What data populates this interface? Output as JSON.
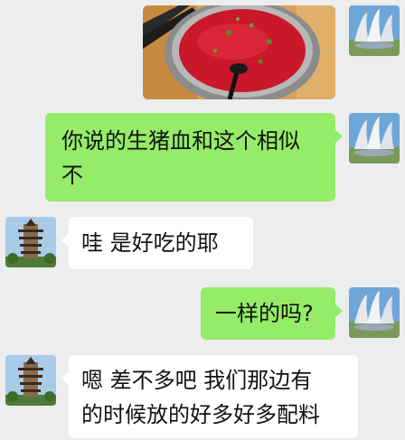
{
  "chat": {
    "messages": [
      {
        "sender": "self",
        "type": "image",
        "image_alt": "a bowl of raw pig blood with a ladle"
      },
      {
        "sender": "self",
        "type": "text",
        "text": "你说的生猪血和这个相似\n不"
      },
      {
        "sender": "other",
        "type": "text",
        "text": "哇 是好吃的耶"
      },
      {
        "sender": "self",
        "type": "text",
        "text": "一样的吗?"
      },
      {
        "sender": "other",
        "type": "text",
        "text": "嗯 差不多吧 我们那边有\n的时候放的好多好多配料"
      }
    ],
    "colors": {
      "background": "#ededed",
      "self_bubble": "#95ec69",
      "other_bubble": "#ffffff"
    },
    "avatars": {
      "self_icon": "sail-roof-building-icon",
      "other_icon": "pagoda-icon"
    }
  }
}
